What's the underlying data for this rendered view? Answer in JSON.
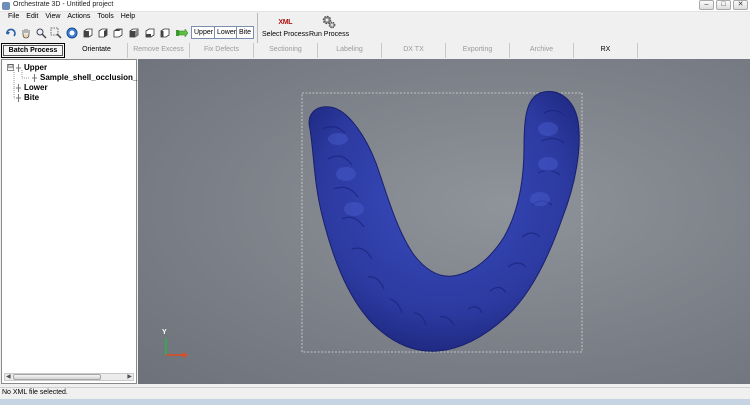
{
  "window": {
    "title": "Orchestrate 3D - Untitled project"
  },
  "menu": [
    "File",
    "Edit",
    "View",
    "Actions",
    "Tools",
    "Help"
  ],
  "toolbar": {
    "icons": [
      "rotate-icon",
      "pan-hand-icon",
      "zoom-icon",
      "zoom-box-icon",
      "zoom-fit-icon",
      "view-cube-front-icon",
      "view-cube-back-icon",
      "view-cube-left-icon",
      "view-cube-right-icon",
      "view-cube-top-icon",
      "view-cube-bottom-icon",
      "move-arrow-icon"
    ],
    "toggles": [
      "Upper",
      "Lower",
      "Bite"
    ],
    "select_process": {
      "label": "Select Process",
      "icon_text": "XML"
    },
    "run_process": {
      "label": "Run Process"
    }
  },
  "tabs": [
    {
      "label": "Batch Process",
      "state": "active"
    },
    {
      "label": "Orientate",
      "state": "enabled"
    },
    {
      "label": "Remove Excess",
      "state": "disabled"
    },
    {
      "label": "Fix Defects",
      "state": "disabled"
    },
    {
      "label": "Sectioning",
      "state": "disabled"
    },
    {
      "label": "Labeling",
      "state": "disabled"
    },
    {
      "label": "DX TX",
      "state": "disabled"
    },
    {
      "label": "Exporting",
      "state": "disabled"
    },
    {
      "label": "Archive",
      "state": "disabled"
    },
    {
      "label": "RX",
      "state": "enabled"
    }
  ],
  "tree": {
    "upper": {
      "label": "Upper",
      "expander": "⊟"
    },
    "upper_child": {
      "label": "Sample_shell_occlusion_"
    },
    "lower": {
      "label": "Lower",
      "expander": "⊞"
    },
    "bite": {
      "label": "Bite",
      "expander": "⊞"
    }
  },
  "viewport": {
    "axis_label": "Y",
    "model_color": "#2e3ea3",
    "background_color": "#7f838a"
  },
  "status": {
    "text": "No XML file selected."
  },
  "colors": {
    "accent": "#2e3ea3",
    "tab_active_border": "#000000"
  }
}
